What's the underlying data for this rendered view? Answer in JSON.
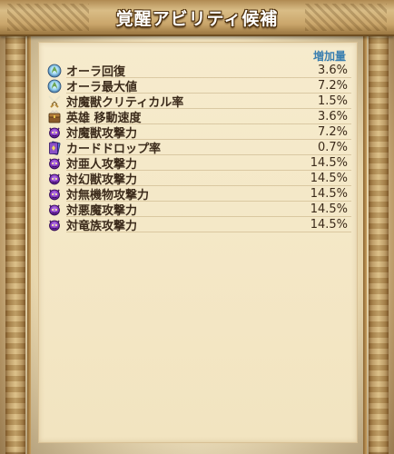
{
  "title": "覚醒アビリティ候補",
  "header_label": "増加量",
  "colors": {
    "header_blue": "#3a7fb0",
    "text_brown": "#3b2a1a"
  },
  "rows": [
    {
      "icon": "aura-orb-icon",
      "name": "オーラ回復",
      "value": "3.6%"
    },
    {
      "icon": "aura-orb-icon",
      "name": "オーラ最大値",
      "value": "7.2%"
    },
    {
      "icon": "crossed-swords-icon",
      "name": "対魔獣クリティカル率",
      "value": "1.5%"
    },
    {
      "icon": "hero-treasure-icon",
      "name": "英雄 移動速度",
      "value": "3.6%"
    },
    {
      "icon": "purple-demon-icon",
      "name": "対魔獣攻撃力",
      "value": "7.2%"
    },
    {
      "icon": "card-drop-icon",
      "name": "カードドロップ率",
      "value": "0.7%"
    },
    {
      "icon": "purple-demon-icon",
      "name": "対亜人攻撃力",
      "value": "14.5%"
    },
    {
      "icon": "purple-demon-icon",
      "name": "対幻獣攻撃力",
      "value": "14.5%"
    },
    {
      "icon": "purple-demon-icon",
      "name": "対無機物攻撃力",
      "value": "14.5%"
    },
    {
      "icon": "purple-demon-icon",
      "name": "対悪魔攻撃力",
      "value": "14.5%"
    },
    {
      "icon": "purple-demon-icon",
      "name": "対竜族攻撃力",
      "value": "14.5%"
    }
  ]
}
